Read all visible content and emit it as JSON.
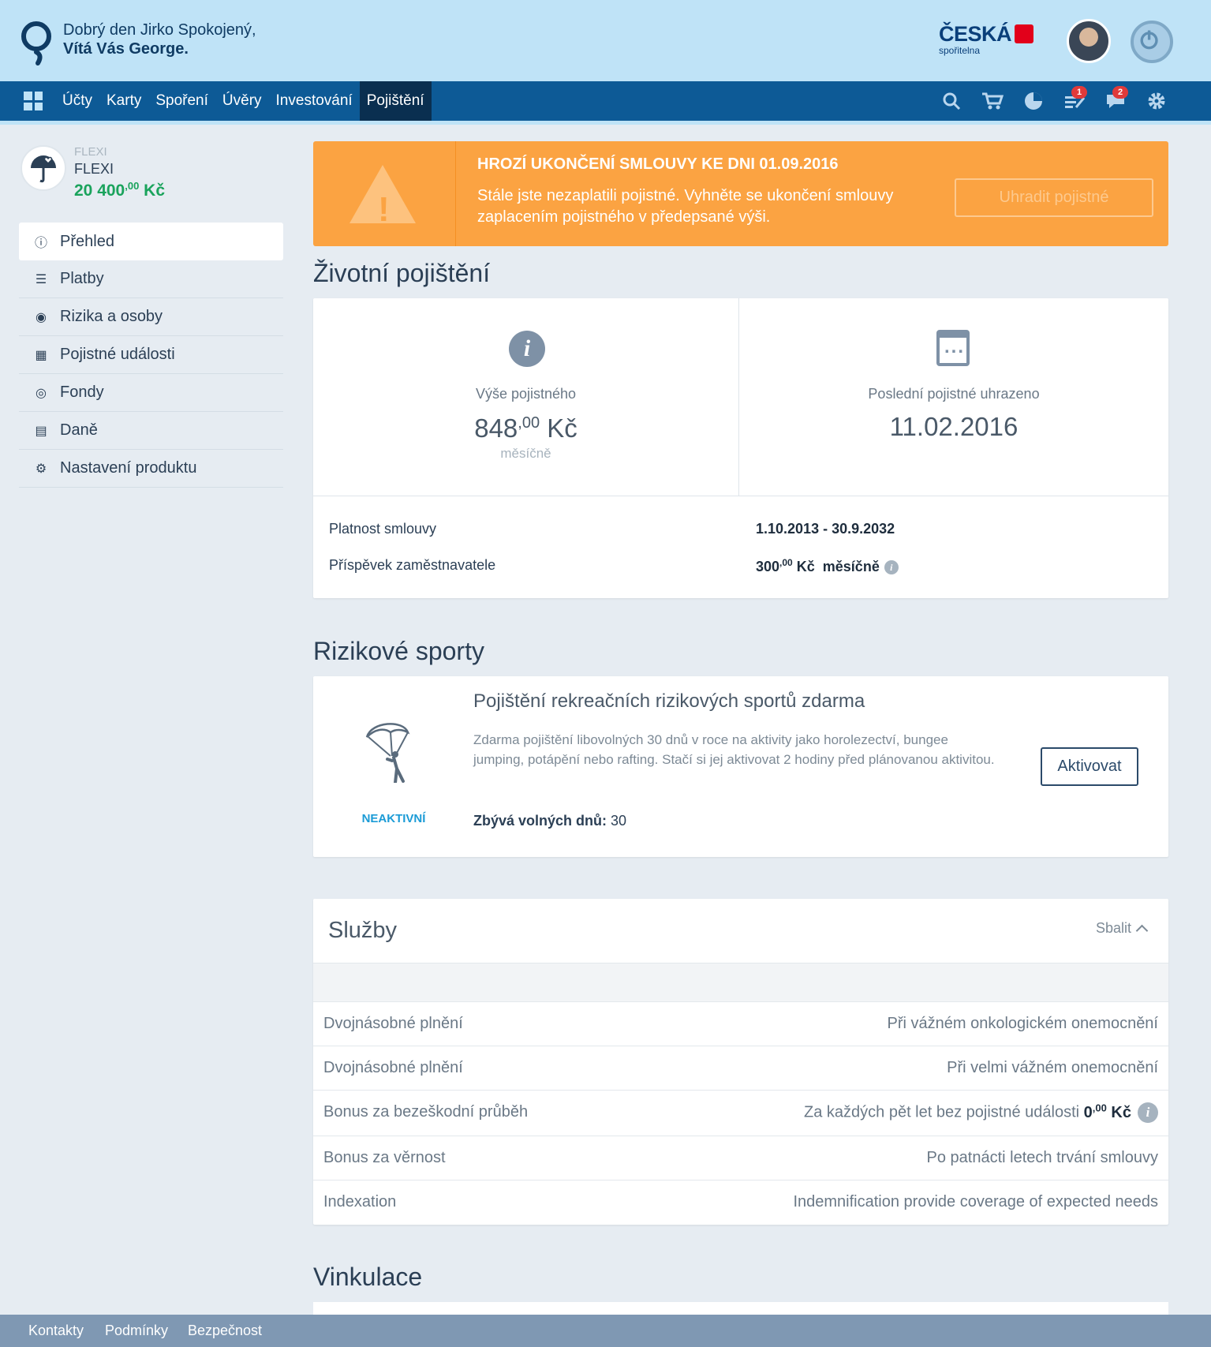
{
  "header": {
    "greeting_line1": "Dobrý den Jirko Spokojený,",
    "greeting_line2": "Vítá Vás George.",
    "bank_name": "ČESKÁ",
    "bank_sub": "spořitelna"
  },
  "nav": {
    "items": [
      "Účty",
      "Karty",
      "Spoření",
      "Úvěry",
      "Investování",
      "Pojištění"
    ],
    "active_item": "Pojištění",
    "badges": {
      "tasks": "1",
      "messages": "2"
    }
  },
  "product": {
    "small_label": "FLEXI",
    "name": "FLEXI",
    "amount_main": "20 400",
    "amount_dec": ",00",
    "currency": "Kč"
  },
  "sidemenu": {
    "items": [
      "Přehled",
      "Platby",
      "Rizika a osoby",
      "Pojistné události",
      "Fondy",
      "Daně",
      "Nastavení produktu"
    ]
  },
  "alert": {
    "title": "HROZÍ UKONČENÍ SMLOUVY KE DNI 01.09.2016",
    "text": "Stále jste nezaplatili pojistné. Vyhněte se ukončení smlouvy zaplacením pojistného v předepsané výši.",
    "button": "Uhradit pojistné"
  },
  "life": {
    "heading": "Životní pojištění",
    "premium_label": "Výše pojistného",
    "premium_main": "848",
    "premium_dec": ",00",
    "premium_currency": "Kč",
    "premium_period": "měsíčně",
    "last_paid_label": "Poslední pojistné uhrazeno",
    "last_paid_date": "11.02.2016",
    "validity_label": "Platnost smlouvy",
    "validity_value": "1.10.2013 - 30.9.2032",
    "employer_label": "Příspěvek zaměstnavatele",
    "employer_main": "300",
    "employer_dec": ",00",
    "employer_currency": "Kč",
    "employer_period": "měsíčně"
  },
  "sports": {
    "heading": "Rizikové sporty",
    "status": "NEAKTIVNÍ",
    "title": "Pojištění rekreačních rizikových sportů zdarma",
    "desc": "Zdarma pojištění libovolných 30 dnů v roce na aktivity jako horolezectví, bungee jumping, potápění nebo rafting. Stačí si jej aktivovat 2 hodiny před plánovanou aktivitou.",
    "days_label": "Zbývá volných dnů:",
    "days_value": "30",
    "button": "Aktivovat"
  },
  "services": {
    "heading": "Služby",
    "collapse": "Sbalit",
    "rows": [
      {
        "k": "Dvojnásobné plnění",
        "v": "Při vážném onkologickém onemocnění"
      },
      {
        "k": "Dvojnásobné plnění",
        "v": "Při velmi vážném onemocnění"
      },
      {
        "k": "Bonus za bezeškodní průběh",
        "v": "Za každých pět let bez pojistné události",
        "amt_main": "0",
        "amt_dec": ",00",
        "amt_cur": "Kč"
      },
      {
        "k": "Bonus za věrnost",
        "v": "Po patnácti letech trvání smlouvy"
      },
      {
        "k": "Indexation",
        "v": "Indemnification provide coverage of expected needs"
      }
    ]
  },
  "vinkulace": {
    "heading": "Vinkulace"
  },
  "footer": {
    "links": [
      "Kontakty",
      "Podmínky",
      "Bezpečnost"
    ]
  }
}
